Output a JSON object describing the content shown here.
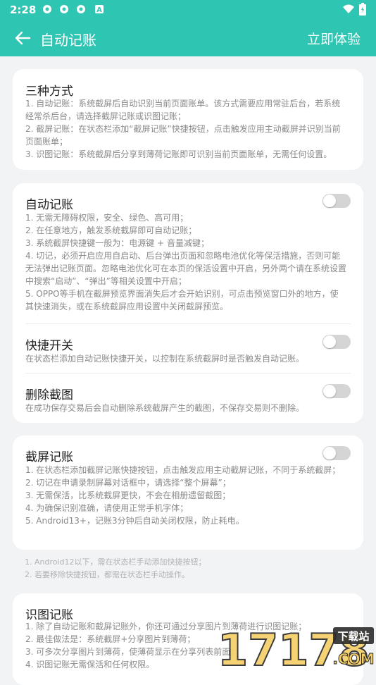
{
  "status": {
    "time": "2:28",
    "notif_icons": [
      "nfc-ring-icon",
      "nfc-ring-icon",
      "nfc-ring-icon",
      "a-icon"
    ]
  },
  "header": {
    "title": "自动记账",
    "action": "立即体验"
  },
  "three_ways": {
    "title": "三种方式",
    "lines": [
      "1. 自动记账：系统截屏后自动识别当前页面账单。该方式需要应用常驻后台，若系统经常杀后台，请选择截屏记账或识图记账；",
      "2. 截屏记账：在状态栏添加“截屏记账”快捷按钮，点击触发应用主动截屏并识别当前页面账单；",
      "3. 识图记账：系统截屏后分享到薄荷记账即可识别当前页面账单，无需任何设置。"
    ]
  },
  "auto": {
    "title": "自动记账",
    "enabled": false,
    "lines": [
      "1. 无需无障碍权限，安全、绿色、高可用；",
      "2. 在任意地方，触发系统截屏即可自动记账；",
      "3. 系统截屏快捷键一般为：电源键 + 音量减键；",
      "4. 切记，必须开启应用自启动、后台弹出页面和忽略电池优化等保活措施，否则可能无法弹出记账页面。忽略电池优化可在本页的保活设置中开启，另外两个请在系统设置中搜索“启动”、“弹出”等相关设置中开启；",
      "5. OPPO等手机在截屏预览界面消失后才会开始识别，可点击预览窗口外的地方，使其快速消失，或在系统截屏应用设置中关闭截屏预览。"
    ],
    "shortcut": {
      "title": "快捷开关",
      "desc": "在状态栏添加自动记账快捷开关，以控制在系统截屏时是否触发自动记账。",
      "enabled": false
    },
    "delete_shot": {
      "title": "删除截图",
      "desc": "在成功保存交易后会自动删除系统截屏产生的截图，不保存交易则不删除。",
      "enabled": false
    }
  },
  "screenshot": {
    "title": "截屏记账",
    "enabled": false,
    "lines": [
      "1. 在状态栏添加截屏记账快捷按钮，点击触发应用主动截屏记账，不同于系统截屏；",
      "2. 切记在申请录制屏幕对话框中，请选择“整个屏幕”；",
      "3. 无需保活，比系统截屏更快，不会在相册遗留截图；",
      "4. 为确保识别准确，请使用正常手机字体；",
      "5. Android13+，记账3分钟后自动关闭权限，防止耗电。"
    ]
  },
  "footnotes": [
    "1. Android12以下，需在状态栏手动添加快捷按钮；",
    "2. 若要移除快捷按钮，都需在状态栏手动操作。"
  ],
  "image_rec": {
    "title": "识图记账",
    "lines": [
      "1. 除了自动记账和截屏记账外，你还可通过分享图片到薄荷进行识图记账；",
      "2. 最佳做法是：系统截屏+分享图片到薄荷；",
      "3. 可多次分享图片到薄荷，使薄荷显示在分享列表前面；",
      "4. 识图记账无需保活和任何权限。"
    ]
  },
  "watermark": {
    "brand": "17178",
    "tag": "下载站",
    "domain": ".COM"
  },
  "colors": {
    "accent": "#2ec5b3",
    "toggle_off": "#d5d5d5",
    "text_secondary": "#8a8a8a"
  }
}
